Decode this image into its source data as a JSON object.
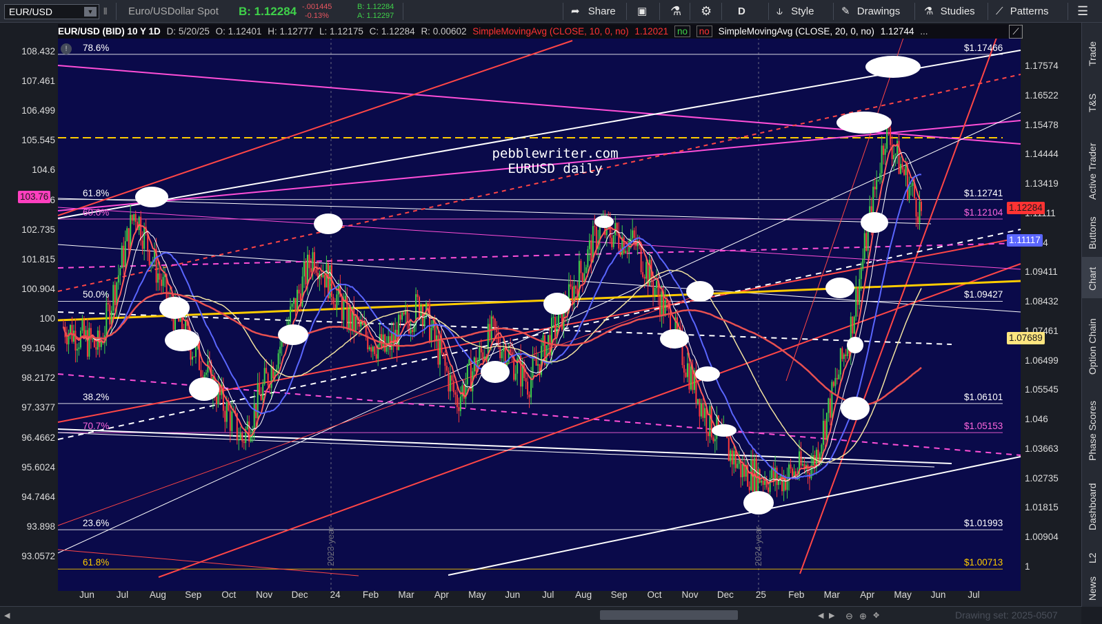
{
  "toolbar": {
    "symbol": "EUR/USD",
    "description": "Euro/USDollar Spot",
    "bid": "B: 1.12284",
    "change": "-.001445",
    "change_pct": "-0.13%",
    "bid_small": "B: 1.12284",
    "ask_small": "A: 1.12297",
    "share": "Share",
    "period": "D",
    "style": "Style",
    "drawings": "Drawings",
    "studies": "Studies",
    "patterns": "Patterns"
  },
  "infobar": {
    "title": "EUR/USD (BID) 10 Y 1D",
    "date": "D: 5/20/25",
    "open": "O: 1.12401",
    "high": "H: 1.12777",
    "low": "L: 1.12175",
    "close": "C: 1.12284",
    "range": "R: 0.00602",
    "sma10": "SimpleMovingAvg (CLOSE, 10, 0, no)",
    "sma10_val": "1.12021",
    "no1": "no",
    "no2": "no",
    "sma20": "SimpleMovingAvg (CLOSE, 20, 0, no)",
    "sma20_val": "1.12744",
    "more": "..."
  },
  "annotation": {
    "line1": "pebblewriter.com",
    "line2": "EURUSD daily"
  },
  "years": [
    "2023 year",
    "2024 year"
  ],
  "chart_data": {
    "type": "line",
    "title": "EUR/USD (BID) 10 Y 1D",
    "x_labels": [
      "Jun",
      "Jul",
      "Aug",
      "Sep",
      "Oct",
      "Nov",
      "Dec",
      "24",
      "Feb",
      "Mar",
      "Apr",
      "May",
      "Jun",
      "Jul",
      "Aug",
      "Sep",
      "Oct",
      "Nov",
      "Dec",
      "25",
      "Feb",
      "Mar",
      "Apr",
      "May",
      "Jun",
      "Jul"
    ],
    "y_left_ticks": [
      "108.432",
      "107.461",
      "106.499",
      "105.545",
      "104.6",
      "103.76",
      "102.735",
      "101.815",
      "100.904",
      "100",
      "99.1046",
      "98.2172",
      "97.3377",
      "96.4662",
      "95.6024",
      "94.7464",
      "93.898",
      "93.0572"
    ],
    "y_right_ticks": [
      "1.17574",
      "1.16522",
      "1.15478",
      "1.14444",
      "1.13419",
      "1.11111",
      "1.104",
      "1.09411",
      "1.08432",
      "1.07461",
      "1.06499",
      "1.05545",
      "1.046",
      "1.03663",
      "1.02735",
      "1.01815",
      "1.00904",
      "1"
    ],
    "y_range": [
      1.0,
      1.18
    ],
    "fib_levels": [
      {
        "label": "78.6%",
        "price": "$1.17466",
        "value": 1.17466
      },
      {
        "label": "61.8%",
        "price": "$1.12741",
        "value": 1.12741
      },
      {
        "label": "60.0%",
        "price": "$1.12104",
        "value": 1.12104
      },
      {
        "label": "50.0%",
        "price": "$1.09427",
        "value": 1.09427
      },
      {
        "label": "38.2%",
        "price": "$1.06101",
        "value": 1.06101
      },
      {
        "label": "70.7%",
        "price": "$1.05153",
        "value": 1.05153
      },
      {
        "label": "23.6%",
        "price": "$1.01993",
        "value": 1.01993
      },
      {
        "label": "61.8%",
        "price": "$1.00713",
        "value": 1.00713
      }
    ],
    "price_series": [
      {
        "date": "2023-05",
        "close": 1.086
      },
      {
        "date": "2023-06",
        "close": 1.079
      },
      {
        "date": "2023-07",
        "close": 1.124
      },
      {
        "date": "2023-08",
        "close": 1.092
      },
      {
        "date": "2023-09",
        "close": 1.071
      },
      {
        "date": "2023-10",
        "close": 1.049
      },
      {
        "date": "2023-11",
        "close": 1.078
      },
      {
        "date": "2023-12",
        "close": 1.11
      },
      {
        "date": "2024-01",
        "close": 1.088
      },
      {
        "date": "2024-02",
        "close": 1.078
      },
      {
        "date": "2024-03",
        "close": 1.094
      },
      {
        "date": "2024-04",
        "close": 1.062
      },
      {
        "date": "2024-05",
        "close": 1.084
      },
      {
        "date": "2024-06",
        "close": 1.068
      },
      {
        "date": "2024-07",
        "close": 1.091
      },
      {
        "date": "2024-08",
        "close": 1.118
      },
      {
        "date": "2024-09",
        "close": 1.113
      },
      {
        "date": "2024-10",
        "close": 1.087
      },
      {
        "date": "2024-11",
        "close": 1.056
      },
      {
        "date": "2024-12",
        "close": 1.039
      },
      {
        "date": "2025-01",
        "close": 1.036
      },
      {
        "date": "2025-02",
        "close": 1.042
      },
      {
        "date": "2025-03",
        "close": 1.084
      },
      {
        "date": "2025-04",
        "close": 1.15
      },
      {
        "date": "2025-05-20",
        "close": 1.12284
      }
    ],
    "badges": [
      {
        "text": "103.76",
        "bg": "#ff3fbf",
        "fg": "#1a1a1a"
      },
      {
        "text": "1.12284",
        "bg": "#ff3333",
        "fg": "#1a1a1a"
      },
      {
        "text": "1.11117",
        "bg": "#5a66ff",
        "fg": "#ffffff"
      },
      {
        "text": "1.07689",
        "bg": "#ffe680",
        "fg": "#1a1a1a"
      }
    ]
  },
  "sidebar": [
    "Trade",
    "T&S",
    "Active Trader",
    "Buttons",
    "Chart",
    "Option Chain",
    "Phase Scores",
    "Dashboard",
    "L2",
    "News"
  ],
  "bottombar": {
    "drawing_set": "Drawing set: 2025-0507"
  },
  "colors": {
    "chart_bg": "#0a0a4a",
    "white_line": "#ffffff",
    "pink": "#ff4fd8",
    "red": "#ff4646",
    "gold": "#ffcc00",
    "blue_ma": "#5a66ff"
  }
}
